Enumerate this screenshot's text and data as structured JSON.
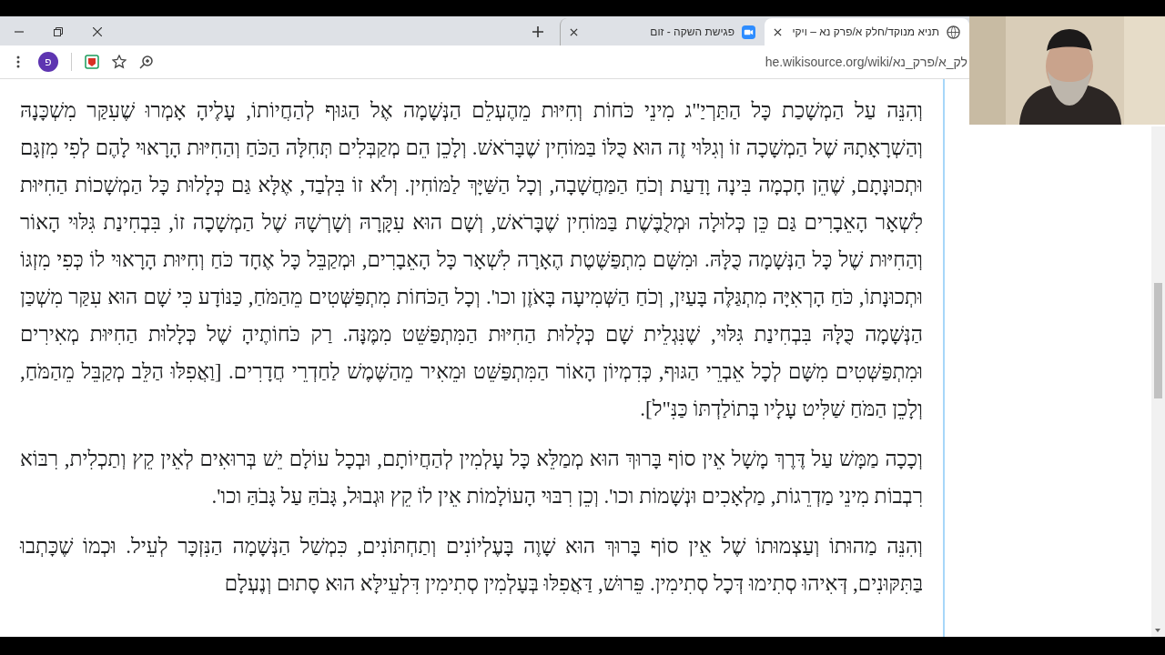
{
  "tabs": [
    {
      "title": "תניא מנוקד/חלק א/פרק נא – ויקי",
      "selected": true,
      "kind": "wiki"
    },
    {
      "title": "פגישת השקה - זום",
      "selected": false,
      "kind": "zoom"
    }
  ],
  "toolbar": {
    "profile_initial": "פ",
    "url": "he.wikisource.org/wiki/לק_א/פרק_נא"
  },
  "article": {
    "paragraphs": [
      "וְהִנֵּה עַל הַמְשָׁכַת כָּל הַתַּרְיַ\"ג מִינֵי כֹּחוֹת וְחִיּוּת מֵהֶעְלֵם הַנְּשָׁמָה אֶל הַגּוּף לְהַחֲיוֹתוֹ, עָלֶיהָ אָמְרוּ שֶׁעִקַּר מִשְׁכָּנָהּ וְהַשְׁרָאָתָהּ שֶׁל הַמְשָׁכָה זוֹ וְגִלּוּי זֶה הוּא כֻּלּוֹ בַּמּוֹחִין שֶׁבָּרֹאשׁ. וְלָכֵן הֵם מְקַבְּלִים תְּחִלָּה הַכֹּחַ וְהַחִיּוּת הָרָאוּי לָהֶם לְפִי מִזְגָּם וּתְכוּנָתָם, שֶׁהֵן חָכְמָה בִּינָה וָדַעַת וְכֹחַ הַמַּחֲשָׁבָה, וְכָל הַשַּׁיָּךְ לַמּוֹחִין. וְלֹא זוֹ בִּלְבַד, אֶלָּא גַּם כְּלָלוּת כָּל הַמְשָׁכוֹת הַחִיּוּת לִשְׁאָר הָאֵבָרִים גַּם כֵּן כְּלוּלָה וּמְלֻבֶּשֶׁת בַּמּוֹחִין שֶׁבָּרֹאשׁ, וְשָׁם הוּא עִקָּרָהּ וְשָׁרְשָׁהּ שֶׁל הַמְשָׁכָה זוֹ, בִּבְחִינַת גִּלּוּי הָאוֹר וְהַחִיּוּת שֶׁל כָּל הַנְּשָׁמָה כֻּלָּהּ. וּמִשָּׁם מִתְפַּשֶּׁטֶת הֶאָרָה לִשְׁאָר כָּל הָאֵבָרִים, וּמְקַבֵּל כָּל אֶחָד כֹּחַ וְחִיּוּת הָרָאוּי לוֹ כְּפִי מִזְגּוֹ וּתְכוּנָתוֹ, כֹּחַ הָרְאִיָּה מִתְגַּלֶּה בָּעַיִן, וְכֹחַ הַשְּׁמִיעָה בָּאֹזֶן וכו'. וְכָל הַכֹּחוֹת מִתְפַּשְּׁטִים מֵהַמֹּחַ, כַּנּוֹדָע כִּי שָׁם הוּא עִקַּר מִשְׁכַּן הַנְּשָׁמָה כֻּלָּהּ בִּבְחִינַת גִּלּוּי, שֶׁנִּגְלֵית שָׁם כְּלָלוּת הַחִיּוּת הַמִּתְפַּשֵּׁט מִמֶּנָּה. רַק כֹּחוֹתֶיהָ שֶׁל כְּלָלוּת הַחִיּוּת מְאִירִים וּמִתְפַּשְּׁטִים מִשָּׁם לְכָל אֵבְרֵי הַגּוּף, כְּדִמְיוֹן הָאוֹר הַמִּתְפַּשֵּׁט וּמֵאִיר מֵהַשֶּׁמֶשׁ לַחַדְרֵי חֲדָרִים. [וַאֲפִלּוּ הַלֵּב מְקַבֵּל מֵהַמֹּחַ, וְלָכֵן הַמֹּחַ שַׁלִּיט עָלָיו בְּתוֹלַדְתּוֹ כַּנִּ\"ל].",
      "וְכָכָה מַמָּשׁ עַל דֶּרֶךְ מָשָׁל אֵין סוֹף בָּרוּךְ הוּא מְמַלֵּא כָּל עָלְמִין לְהַחֲיוֹתָם, וּבְכָל עוֹלָם יֵשׁ בְּרוּאִים לְאֵין קֵץ וְתַכְלִית, רִבּוֹא רִבְבוֹת מִינֵי מַדְרֵגוֹת, מַלְאָכִים וּנְשָׁמוֹת וכו'. וְכֵן רִבּוּי הָעוֹלָמוֹת אֵין לוֹ קֵץ וּגְבוּל, גָּבֹהַּ עַל גָּבֹהַּ וכו'.",
      "וְהִנֵּה מַהוּתוֹ וְעַצְמוּתוֹ שֶׁל אֵין סוֹף בָּרוּךְ הוּא שָׁוֶה בָּעֶלְיוֹנִים וְתַחְתּוֹנִים, כִּמְשַׁל הַנְּשָׁמָה הַנִּזְכָּר לְעֵיל. וּכְמוֹ שֶׁכָּתְבוּ בַּתִּקּוּנִים, דְּאִיהוּ סְתִימוּ דְּכָל סְתִימִין. פֵּרוּשׁ, דַּאֲפִלּוּ בְּעָלְמִין סְתִימִין דִּלְעֵילָּא הוּא סָתוּם וְנֶעְלָם"
    ]
  }
}
